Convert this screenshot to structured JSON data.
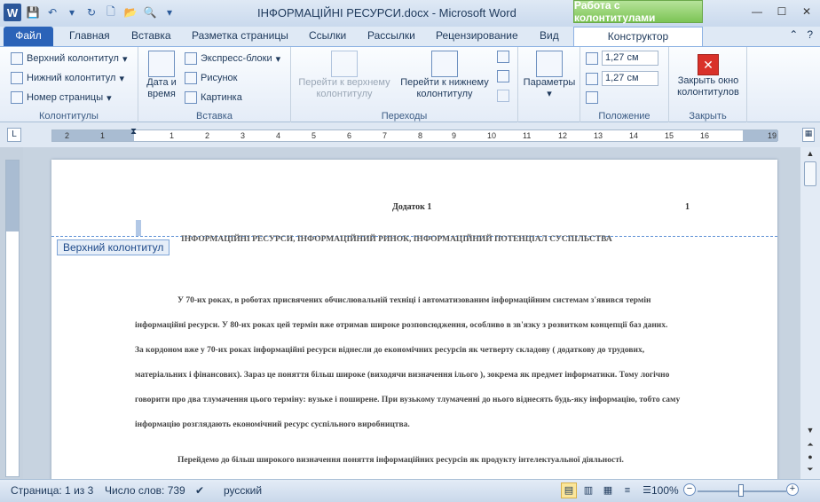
{
  "titlebar": {
    "title": "ІНФОРМАЦІЙНІ РЕСУРСИ.docx - Microsoft Word",
    "context_tab": "Работа с колонтитулами",
    "app_icon": "W"
  },
  "tabs": [
    "Файл",
    "Главная",
    "Вставка",
    "Разметка страницы",
    "Ссылки",
    "Рассылки",
    "Рецензирование",
    "Вид",
    "Конструктор"
  ],
  "ribbon": {
    "hf_group": {
      "label": "Колонтитулы",
      "items": [
        "Верхний колонтитул",
        "Нижний колонтитул",
        "Номер страницы"
      ]
    },
    "insert_group": {
      "label": "Вставка",
      "date_time": "Дата и\nвремя",
      "items": [
        "Экспресс-блоки",
        "Рисунок",
        "Картинка"
      ]
    },
    "nav_group": {
      "label": "Переходы",
      "goto_header": "Перейти к верхнему\nколонтитулу",
      "goto_footer": "Перейти к нижнему\nколонтитулу"
    },
    "params_group": {
      "label": "Параметры"
    },
    "pos_group": {
      "label": "Положение",
      "header_dist": "1,27 см",
      "footer_dist": "1,27 см"
    },
    "close_group": {
      "label": "Закрыть",
      "close_btn": "Закрыть окно\nколонтитулов"
    }
  },
  "ruler": {
    "ticks": [
      "2",
      "1",
      "1",
      "2",
      "3",
      "4",
      "5",
      "6",
      "7",
      "8",
      "9",
      "10",
      "11",
      "12",
      "13",
      "14",
      "15",
      "16",
      "17",
      "19"
    ]
  },
  "document": {
    "header_text": "Додаток 1",
    "page_number": "1",
    "header_tag": "Верхний колонтитул",
    "heading": "ІНФОРМАЦІЙНІ РЕСУРСИ, ІНФОРМАЦІЙНИЙ РИНОК, ІНФОРМАЦІЙНИЙ ПОТЕНЦІАЛ СУСПІЛЬСТВА",
    "lines": [
      "У 70-их роках, в роботах присвячених обчислювальній техніці і автоматизованим інформаційним системам з'явився термін",
      "інформаційні ресурси. У 80-их роках цей термін вже отримав широке розповсюдження, особливо в зв'язку з розвитком концепції баз даних.",
      "За кордоном вже у 70-их роках інформаційні ресурси віднесли до економічних ресурсів як четверту складову ( додаткову до трудових,",
      "матеріальних і фінансових). Зараз це поняття більш широке (виходячи визначення ілього ), зокрема як предмет інформатики. Тому логічно",
      "говорити про два тлумачення цього терміну: вузьке і поширене. При вузькому тлумаченні до нього віднесять будь-яку інформацію, тобто саму",
      "інформацію розглядають економічний ресурс суспільного виробництва.",
      "Перейдемо до більш широкого визначення поняття інформаційних ресурсів як продукту інтелектуальної діяльності."
    ]
  },
  "statusbar": {
    "page": "Страница: 1 из 3",
    "words": "Число слов: 739",
    "language": "русский",
    "zoom": "100%"
  },
  "colors": {
    "file_tab": "#2b63b8",
    "context": "#7cc455",
    "header_line": "#5b8fd4"
  }
}
